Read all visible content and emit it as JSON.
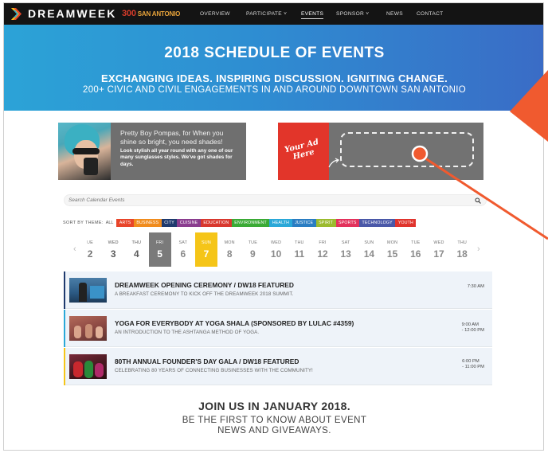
{
  "nav": {
    "brand": "DREAMWEEK",
    "partner_number": "300",
    "partner_name": "SAN ANTONIO",
    "items": [
      {
        "label": "OVERVIEW"
      },
      {
        "label": "PARTICIPATE ˅"
      },
      {
        "label": "EVENTS"
      },
      {
        "label": "SPONSOR ˅"
      },
      {
        "label": "NEWS"
      },
      {
        "label": "CONTACT"
      }
    ]
  },
  "hero": {
    "title": "2018 SCHEDULE OF EVENTS",
    "tagline": "EXCHANGING IDEAS. INSPIRING DISCUSSION. IGNITING CHANGE.",
    "subtitle": "200+ CIVIC AND CIVIL ENGAGEMENTS IN AND AROUND DOWNTOWN SAN ANTONIO"
  },
  "ads": {
    "sunglasses": {
      "title": "Pretty Boy Pompas, for When you shine so bright, you need shades!",
      "body": "Look stylish all year round with any one of our many sunglasses styles. We've got shades for days."
    },
    "placeholder": {
      "script": "Your Ad Here"
    }
  },
  "search": {
    "placeholder": "Search Calendar Events"
  },
  "themes": {
    "label": "SORT BY THEME:",
    "all": "ALL",
    "tags": [
      {
        "label": "ARTS",
        "color": "#e8452a"
      },
      {
        "label": "BUSINESS",
        "color": "#f08c1e"
      },
      {
        "label": "CITY",
        "color": "#1e3a6e"
      },
      {
        "label": "CUISINE",
        "color": "#8a3d8f"
      },
      {
        "label": "EDUCATION",
        "color": "#d8382e"
      },
      {
        "label": "ENVIRONMENT",
        "color": "#3aaa35"
      },
      {
        "label": "HEALTH",
        "color": "#2aa8d8"
      },
      {
        "label": "JUSTICE",
        "color": "#2a7dc2"
      },
      {
        "label": "SPIRIT",
        "color": "#9bbb2e"
      },
      {
        "label": "SPORTS",
        "color": "#e3325c"
      },
      {
        "label": "TECHNOLOGY",
        "color": "#4a58a8"
      },
      {
        "label": "YOUTH",
        "color": "#e0342d"
      }
    ]
  },
  "dates": [
    {
      "dow": "UE",
      "num": "2",
      "state": "past"
    },
    {
      "dow": "WED",
      "num": "3",
      "state": "past"
    },
    {
      "dow": "THU",
      "num": "4",
      "state": "past"
    },
    {
      "dow": "FRI",
      "num": "5",
      "state": "selected"
    },
    {
      "dow": "SAT",
      "num": "6",
      "state": "future"
    },
    {
      "dow": "SUN",
      "num": "7",
      "state": "today"
    },
    {
      "dow": "MON",
      "num": "8",
      "state": "future"
    },
    {
      "dow": "TUE",
      "num": "9",
      "state": "future"
    },
    {
      "dow": "WED",
      "num": "10",
      "state": "future"
    },
    {
      "dow": "THU",
      "num": "11",
      "state": "future"
    },
    {
      "dow": "FRI",
      "num": "12",
      "state": "future"
    },
    {
      "dow": "SAT",
      "num": "13",
      "state": "future"
    },
    {
      "dow": "SUN",
      "num": "14",
      "state": "future"
    },
    {
      "dow": "MON",
      "num": "15",
      "state": "future"
    },
    {
      "dow": "TUE",
      "num": "16",
      "state": "future"
    },
    {
      "dow": "WED",
      "num": "17",
      "state": "future"
    },
    {
      "dow": "THU",
      "num": "18",
      "state": "future"
    }
  ],
  "events": [
    {
      "title": "DREAMWEEK OPENING CEREMONY / DW18 FEATURED",
      "subtitle": "A BREAKFAST CEREMONY TO KICK OFF THE DREAMWEEK 2018 SUMMIT.",
      "time_start": "7:30 AM",
      "time_end": "",
      "accent": "#1e3a6e"
    },
    {
      "title": "YOGA FOR EVERYBODY AT YOGA SHALA (SPONSORED BY LULAC #4359)",
      "subtitle": "AN INTRODUCTION TO THE ASHTANGA METHOD OF YOGA.",
      "time_start": "9:00 AM",
      "time_end": "- 12:00 PM",
      "accent": "#2aa8d8"
    },
    {
      "title": "80TH ANNUAL FOUNDER'S DAY GALA / DW18 FEATURED",
      "subtitle": "CELEBRATING 80 YEARS OF CONNECTING BUSINESSES WITH THE COMMUNITY!",
      "time_start": "6:00 PM",
      "time_end": "- 11:00 PM",
      "accent": "#f5c518"
    }
  ],
  "cta": {
    "heading": "JOIN US IN JANUARY 2018.",
    "line1": "BE THE FIRST TO KNOW  ABOUT EVENT",
    "line2": "NEWS AND  GIVEAWAYS."
  }
}
